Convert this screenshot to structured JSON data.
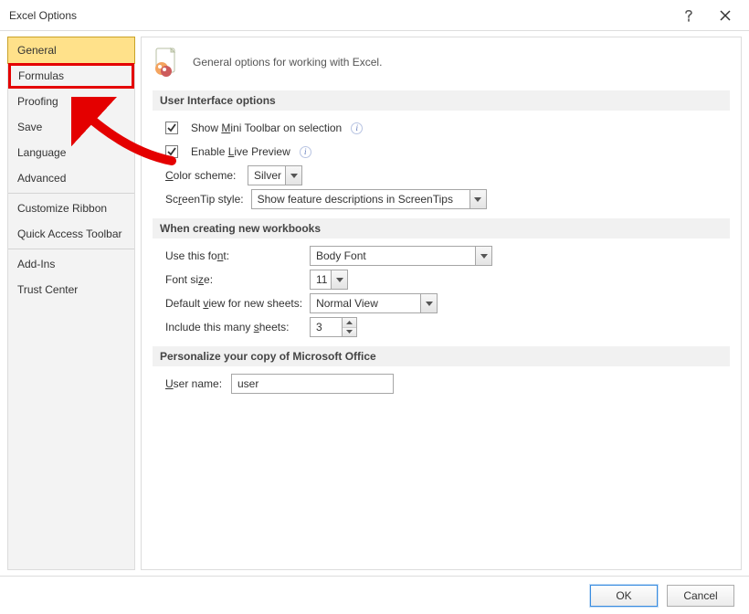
{
  "title": "Excel Options",
  "sidebar": {
    "items": [
      {
        "label": "General",
        "selected": true,
        "highlight": false
      },
      {
        "label": "Formulas",
        "selected": false,
        "highlight": true
      },
      {
        "label": "Proofing",
        "selected": false
      },
      {
        "label": "Save",
        "selected": false
      },
      {
        "label": "Language",
        "selected": false
      },
      {
        "label": "Advanced",
        "selected": false
      },
      {
        "label": "Customize Ribbon",
        "selected": false,
        "sep_before": true
      },
      {
        "label": "Quick Access Toolbar",
        "selected": false
      },
      {
        "label": "Add-Ins",
        "selected": false,
        "sep_before": true
      },
      {
        "label": "Trust Center",
        "selected": false
      }
    ]
  },
  "header": {
    "description": "General options for working with Excel."
  },
  "sections": {
    "ui": {
      "title": "User Interface options",
      "show_mini_pre": "Show ",
      "show_mini_u": "M",
      "show_mini_post": "ini Toolbar on selection",
      "show_mini_checked": true,
      "enable_live_pre": "Enable ",
      "enable_live_u": "L",
      "enable_live_post": "ive Preview",
      "enable_live_checked": true,
      "color_scheme_pre": "",
      "color_scheme_u": "C",
      "color_scheme_post": "olor scheme:",
      "color_scheme_value": "Silver",
      "screentip_pre": "Sc",
      "screentip_u": "r",
      "screentip_post": "eenTip style:",
      "screentip_value": "Show feature descriptions in ScreenTips"
    },
    "workbooks": {
      "title": "When creating new workbooks",
      "font_pre": "Use this fo",
      "font_u": "n",
      "font_post": "t:",
      "font_value": "Body Font",
      "fontsize_pre": "Font si",
      "fontsize_u": "z",
      "fontsize_post": "e:",
      "fontsize_value": "11",
      "view_pre": "Default ",
      "view_u": "v",
      "view_post": "iew for new sheets:",
      "view_value": "Normal View",
      "sheets_pre": "Include this many ",
      "sheets_u": "s",
      "sheets_post": "heets:",
      "sheets_value": "3"
    },
    "personalize": {
      "title": "Personalize your copy of Microsoft Office",
      "user_pre": "",
      "user_u": "U",
      "user_post": "ser name:",
      "user_value": "user"
    }
  },
  "footer": {
    "ok": "OK",
    "cancel": "Cancel"
  }
}
